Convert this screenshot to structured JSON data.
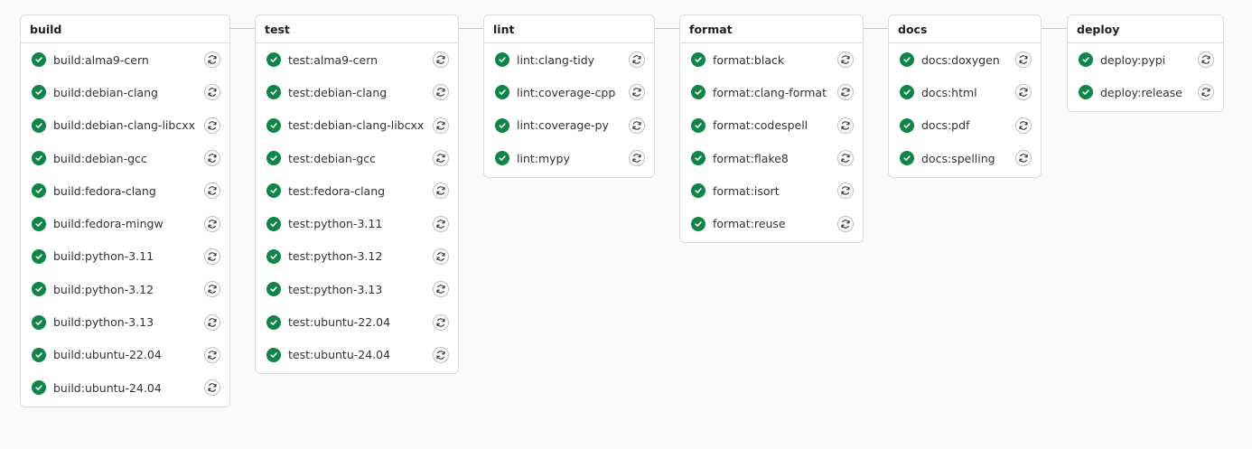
{
  "stages": [
    {
      "title": "build",
      "jobs": [
        "build:alma9-cern",
        "build:debian-clang",
        "build:debian-clang-libcxx",
        "build:debian-gcc",
        "build:fedora-clang",
        "build:fedora-mingw",
        "build:python-3.11",
        "build:python-3.12",
        "build:python-3.13",
        "build:ubuntu-22.04",
        "build:ubuntu-24.04"
      ]
    },
    {
      "title": "test",
      "jobs": [
        "test:alma9-cern",
        "test:debian-clang",
        "test:debian-clang-libcxx",
        "test:debian-gcc",
        "test:fedora-clang",
        "test:python-3.11",
        "test:python-3.12",
        "test:python-3.13",
        "test:ubuntu-22.04",
        "test:ubuntu-24.04"
      ]
    },
    {
      "title": "lint",
      "jobs": [
        "lint:clang-tidy",
        "lint:coverage-cpp",
        "lint:coverage-py",
        "lint:mypy"
      ]
    },
    {
      "title": "format",
      "jobs": [
        "format:black",
        "format:clang-format",
        "format:codespell",
        "format:flake8",
        "format:isort",
        "format:reuse"
      ]
    },
    {
      "title": "docs",
      "jobs": [
        "docs:doxygen",
        "docs:html",
        "docs:pdf",
        "docs:spelling"
      ]
    },
    {
      "title": "deploy",
      "jobs": [
        "deploy:pypi",
        "deploy:release"
      ]
    }
  ],
  "status_icon": "check-circle-icon",
  "retry_icon": "retry-icon",
  "colors": {
    "success": "#108548",
    "border": "#dcdcde",
    "background": "#fafafa"
  }
}
